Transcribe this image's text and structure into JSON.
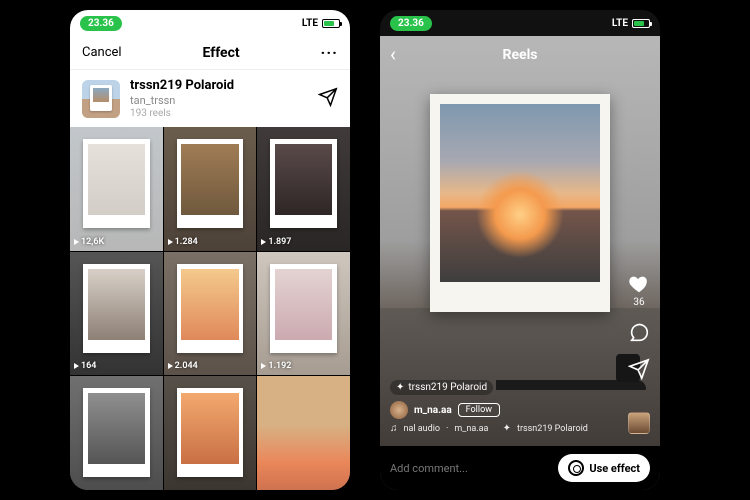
{
  "status": {
    "time": "23.36",
    "net": "LTE"
  },
  "left": {
    "cancel": "Cancel",
    "title": "Effect",
    "effect": {
      "name": "trssn219 Polaroid",
      "author": "tan_trssn",
      "count": "193 reels"
    },
    "grid": [
      {
        "plays": "12,6K"
      },
      {
        "plays": "1.284"
      },
      {
        "plays": "1.897"
      },
      {
        "plays": "164"
      },
      {
        "plays": "2.044"
      },
      {
        "plays": "1.192"
      },
      {
        "plays": ""
      },
      {
        "plays": ""
      },
      {
        "plays": ""
      }
    ]
  },
  "right": {
    "header": "Reels",
    "likes": "36",
    "effect_tag": "trssn219 Polaroid",
    "username": "m_na.aa",
    "follow": "Follow",
    "audio": "nal audio",
    "audio_user": "m_na.aa",
    "audio_effect": "trssn219 Polaroid",
    "comment_placeholder": "Add comment...",
    "use_effect": "Use effect"
  }
}
